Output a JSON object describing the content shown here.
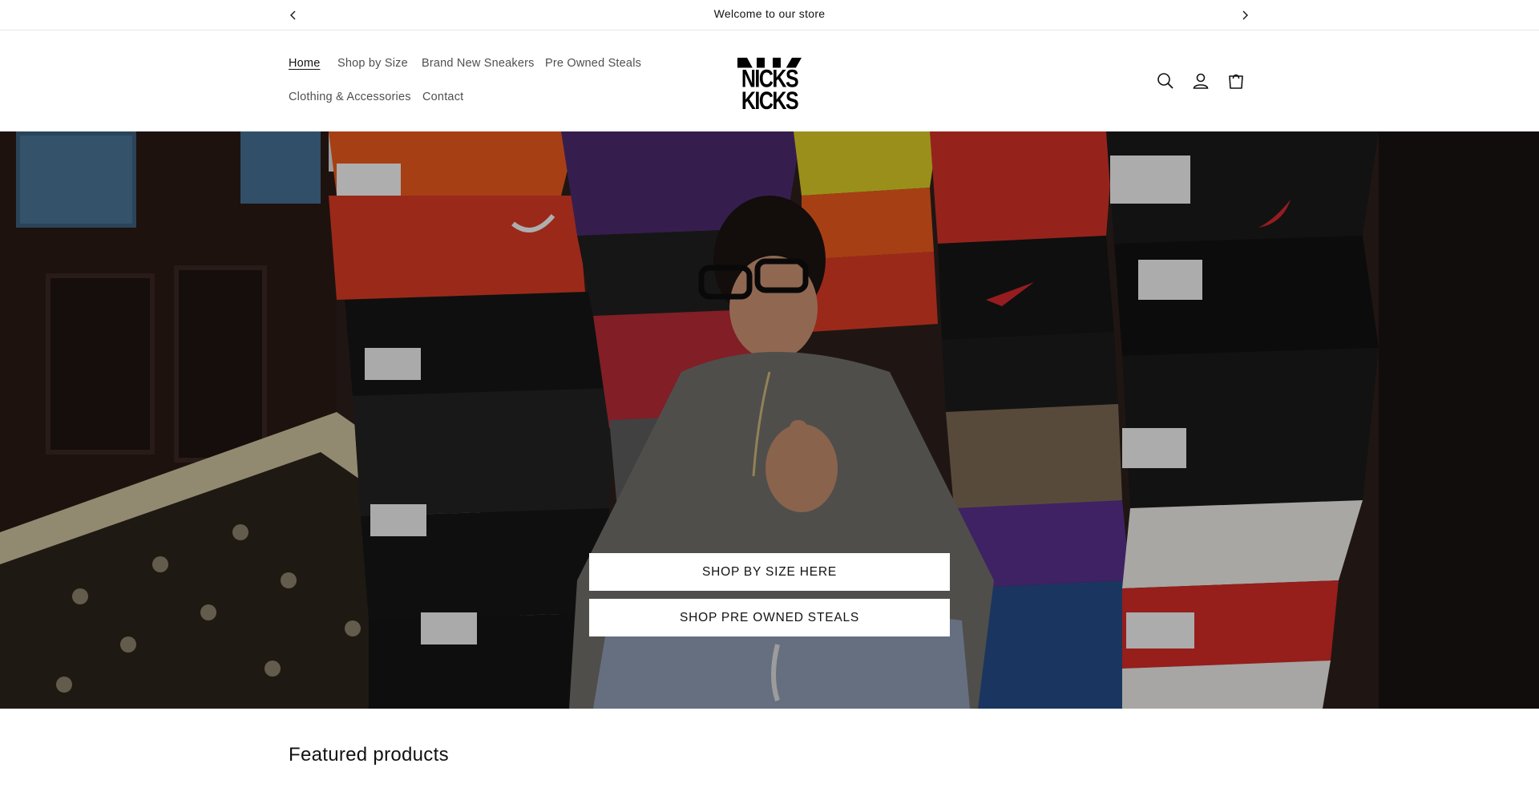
{
  "announcement": {
    "message": "Welcome to our store",
    "prev_icon": "chevron-left-icon",
    "next_icon": "chevron-right-icon"
  },
  "header": {
    "nav": [
      {
        "label": "Home",
        "active": true
      },
      {
        "label": "Shop by Size",
        "active": false
      },
      {
        "label": "Brand New Sneakers",
        "active": false
      },
      {
        "label": "Pre Owned Steals",
        "active": false
      },
      {
        "label": "Clothing & Accessories",
        "active": false
      },
      {
        "label": "Contact",
        "active": false
      }
    ],
    "logo": {
      "monogram": "NK",
      "text": "NICKS KICKS"
    },
    "icons": [
      "search-icon",
      "account-icon",
      "cart-icon"
    ]
  },
  "hero": {
    "buttons": [
      {
        "label": "SHOP BY SIZE HERE"
      },
      {
        "label": "SHOP PRE OWNED STEALS"
      }
    ]
  },
  "featured": {
    "title": "Featured products"
  },
  "colors": {
    "text": "#121212",
    "background": "#ffffff",
    "nike_red": "#c8262c",
    "box_orange": "#e8581e",
    "box_black": "#1c1c1c"
  }
}
